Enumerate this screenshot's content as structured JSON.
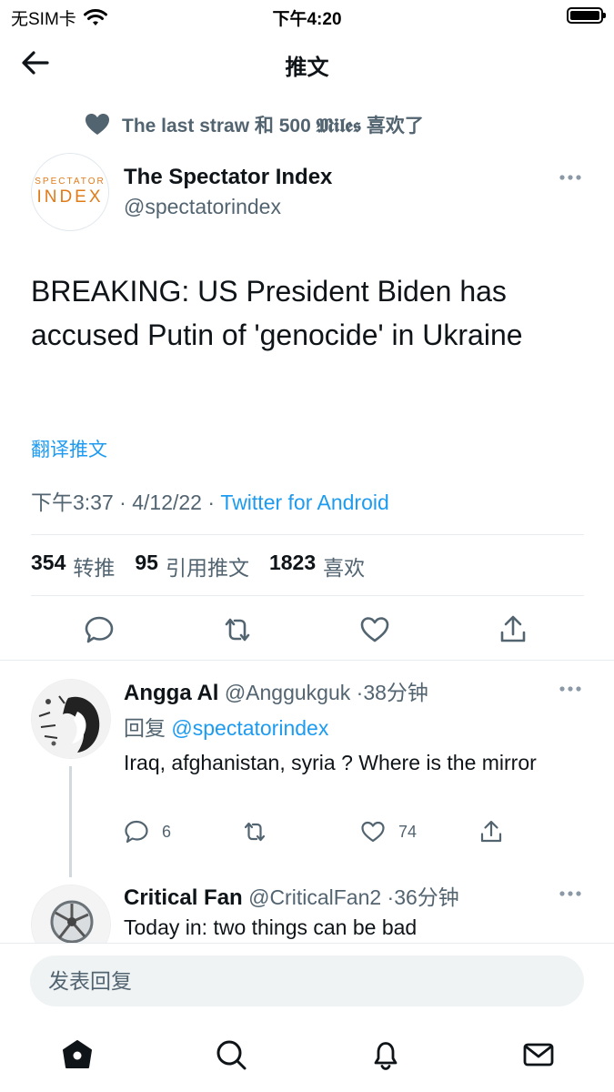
{
  "status_bar": {
    "carrier": "无SIM卡",
    "time": "下午4:20"
  },
  "header": {
    "title": "推文"
  },
  "social_context": {
    "text": "The last straw 和 500 𝕸𝖎𝖑𝖊𝖘 喜欢了"
  },
  "tweet": {
    "avatar_top": "SPECTATOR",
    "avatar_bottom": "INDEX",
    "author_name": "The Spectator Index",
    "author_handle": "@spectatorindex",
    "text": "BREAKING: US President Biden has accused Putin of 'genocide' in Ukraine",
    "translate_label": "翻译推文",
    "time": "下午3:37",
    "date": "4/12/22",
    "source": "Twitter for Android",
    "retweets_count": "354",
    "retweets_label": "转推",
    "quotes_count": "95",
    "quotes_label": "引用推文",
    "likes_count": "1823",
    "likes_label": "喜欢"
  },
  "replies": [
    {
      "name": "Angga Al",
      "handle": "@Anggukguk",
      "time": "38分钟",
      "reply_prefix": "回复",
      "reply_mention": "@spectatorindex",
      "text": "Iraq, afghanistan, syria ? Where is the mirror",
      "reply_count": "6",
      "like_count": "74"
    },
    {
      "name": "Critical Fan",
      "handle": "@CriticalFan2",
      "time": "36分钟",
      "text": "Today in: two things can be bad"
    }
  ],
  "compose": {
    "placeholder": "发表回复"
  },
  "colors": {
    "accent": "#1d9bf0",
    "secondary": "#536471",
    "text": "#0f1419",
    "divider": "#e6ecf0"
  },
  "icons": [
    "back-arrow-icon",
    "heart-icon",
    "more-icon",
    "reply-icon",
    "retweet-icon",
    "like-icon",
    "share-icon",
    "home-icon",
    "search-icon",
    "notifications-icon",
    "messages-icon",
    "wifi-icon",
    "battery-icon"
  ]
}
